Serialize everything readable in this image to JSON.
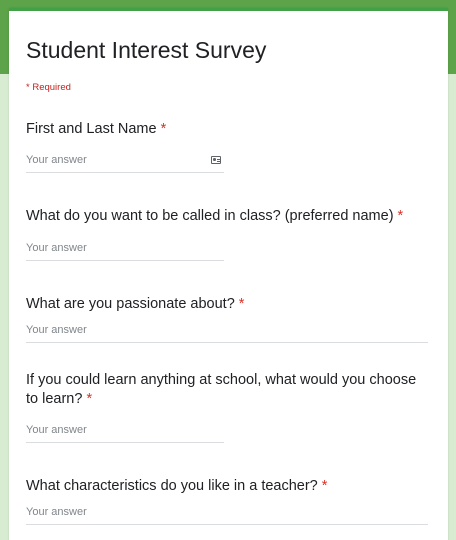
{
  "form": {
    "title": "Student Interest Survey",
    "required_note": "* Required"
  },
  "questions": [
    {
      "label": "First and Last Name",
      "required_mark": "*",
      "placeholder": "Your answer",
      "icon": "contact-card-icon"
    },
    {
      "label": "What do you want to be called in class? (preferred name)",
      "required_mark": "*",
      "placeholder": "Your answer"
    },
    {
      "label": "What are you passionate about?",
      "required_mark": "*",
      "placeholder": "Your answer"
    },
    {
      "label": "If you could learn anything at school, what would you choose to learn?",
      "required_mark": "*",
      "placeholder": "Your answer"
    },
    {
      "label": "What characteristics do you like in a teacher?",
      "required_mark": "*",
      "placeholder": "Your answer"
    }
  ],
  "colors": {
    "theme_green": "#5ca34a",
    "background": "#d7ecd1",
    "required_red": "#d93025"
  }
}
